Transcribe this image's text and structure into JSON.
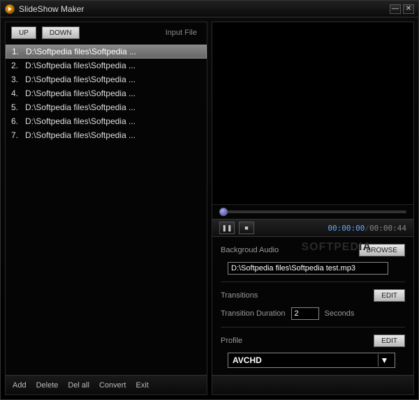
{
  "titlebar": {
    "title": "SlideShow Maker"
  },
  "left": {
    "up_btn": "UP",
    "down_btn": "DOWN",
    "col_label": "Input File",
    "files": [
      {
        "num": "1.",
        "name": "D:\\Softpedia files\\Softpedia ...",
        "selected": true
      },
      {
        "num": "2.",
        "name": "D:\\Softpedia files\\Softpedia ...",
        "selected": false
      },
      {
        "num": "3.",
        "name": "D:\\Softpedia files\\Softpedia ...",
        "selected": false
      },
      {
        "num": "4.",
        "name": "D:\\Softpedia files\\Softpedia ...",
        "selected": false
      },
      {
        "num": "5.",
        "name": "D:\\Softpedia files\\Softpedia ...",
        "selected": false
      },
      {
        "num": "6.",
        "name": "D:\\Softpedia files\\Softpedia ...",
        "selected": false
      },
      {
        "num": "7.",
        "name": "D:\\Softpedia files\\Softpedia ...",
        "selected": false
      }
    ],
    "footer": {
      "add": "Add",
      "delete": "Delete",
      "del_all": "Del all",
      "convert": "Convert",
      "exit": "Exit"
    }
  },
  "right": {
    "time_current": "00:00:00",
    "time_total": "00:00:44",
    "audio_label": "Backgroud Audio",
    "browse_btn": "BROWSE",
    "audio_path": "D:\\Softpedia files\\Softpedia test.mp3",
    "transitions_label": "Transitions",
    "edit_btn": "EDIT",
    "duration_label": "Transition Duration",
    "duration_value": "2",
    "duration_unit": "Seconds",
    "profile_label": "Profile",
    "profile_value": "AVCHD",
    "watermark": "SOFTPEDIA"
  }
}
